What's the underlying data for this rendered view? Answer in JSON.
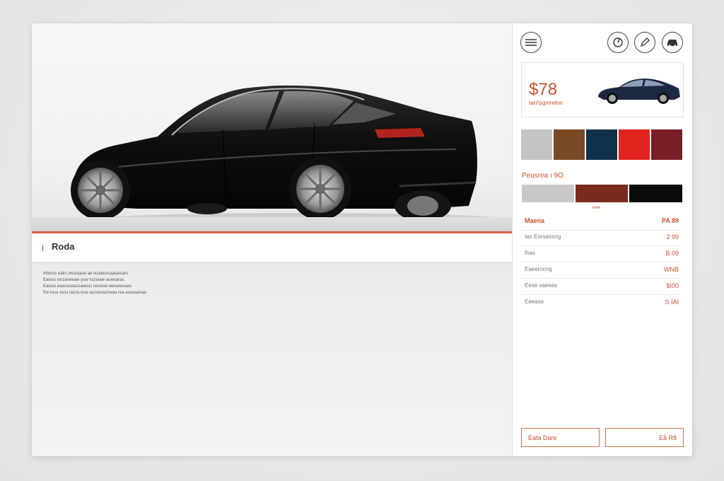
{
  "main": {
    "page_title": "Roda",
    "description_lines": [
      "Intenss ealrs wssraase ae wzaeuvsaasalsars",
      "Eawsu wozaneeaw  yuw tozseaw auwsaras",
      "Eawsu eswossoezsawoss reswsw weswwoaes",
      "Ew tosa zess tazza esw aszsesazzwaa raa asusaanaa"
    ]
  },
  "sidebar": {
    "icons": [
      "menu-icon",
      "speed-icon",
      "pen-icon",
      "car-front-icon"
    ],
    "price": "$78",
    "price_subtitle": "Ianl'pgmrelon",
    "colors": [
      "#c4c4c4",
      "#7a4a26",
      "#12304a",
      "#e2241f",
      "#7a1e26"
    ],
    "interior_label": "Peusrea ı 9O",
    "interior_colors": [
      "#c8c8c8",
      "#7a2a1e",
      "#0c0c0c"
    ],
    "interior_caption": "ewe",
    "specs_header": {
      "label": "Maena",
      "value": "PA 89"
    },
    "specs": [
      {
        "label": "Ias Eorsaosng",
        "value": "2 99"
      },
      {
        "label": "Ihas",
        "value": "B 09"
      },
      {
        "label": "Eaeerocng",
        "value": "WNB"
      },
      {
        "label": "Eese vaeeas",
        "value": "$I00"
      },
      {
        "label": "Eeease",
        "value": "S IAI"
      }
    ],
    "buttons": {
      "secondary": "Eata Dare",
      "primary": "Eå R8"
    }
  }
}
